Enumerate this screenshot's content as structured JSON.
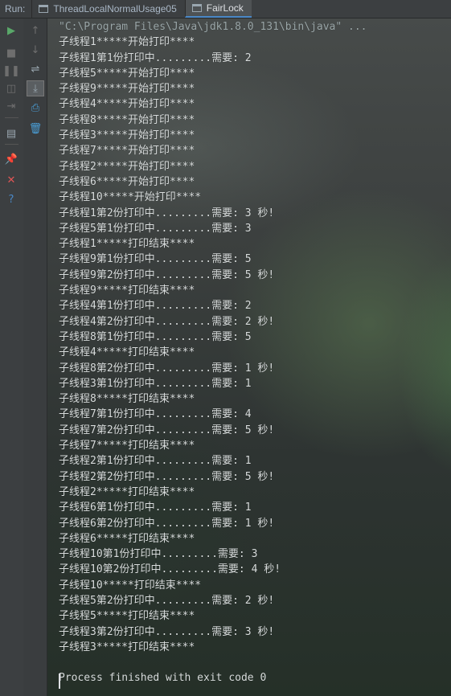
{
  "window": {
    "run_label": "Run:",
    "tabs": [
      {
        "label": "ThreadLocalNormalUsage05",
        "active": false
      },
      {
        "label": "FairLock",
        "active": true
      }
    ]
  },
  "colors": {
    "background": "#2b2d2e",
    "toolbar": "#3c3f41",
    "run_green": "#59a869",
    "close_red": "#e05555",
    "help_blue": "#4a88c7",
    "text": "#d8dcdc"
  },
  "toolbar_left": [
    {
      "name": "rerun-icon",
      "glyph": "▶",
      "color": "#59a869"
    },
    {
      "name": "stop-icon",
      "glyph": "■",
      "color": "#6e6e6e"
    },
    {
      "name": "pause-icon",
      "glyph": "❚❚",
      "color": "#6e6e6e"
    },
    {
      "name": "camera-icon",
      "glyph": "◫",
      "color": "#6e6e6e"
    },
    {
      "name": "exit-icon",
      "glyph": "⇥",
      "color": "#6e6e6e"
    },
    {
      "name": "dump-threads-icon",
      "glyph": "▤",
      "color": "#9aa7b0"
    },
    {
      "name": "pin-tab-icon",
      "glyph": "📌",
      "color": "#c75450"
    },
    {
      "name": "close-icon",
      "glyph": "✕",
      "color": "#e05555"
    },
    {
      "name": "help-icon",
      "glyph": "?",
      "color": "#4a88c7"
    }
  ],
  "toolbar_right": [
    {
      "name": "up-icon",
      "glyph": "↑",
      "color": "#6e6e6e"
    },
    {
      "name": "down-icon",
      "glyph": "↓",
      "color": "#6e6e6e"
    },
    {
      "name": "soft-wrap-icon",
      "glyph": "⇌",
      "color": "#9aa7b0"
    },
    {
      "name": "scroll-to-end-icon",
      "glyph": "⤓",
      "color": "#9aa7b0"
    },
    {
      "name": "print-icon",
      "glyph": "⎙",
      "color": "#4a9fd8"
    },
    {
      "name": "clear-all-icon",
      "glyph": "🗑",
      "color": "#4a9fd8"
    }
  ],
  "console": {
    "lines": [
      "\"C:\\Program Files\\Java\\jdk1.8.0_131\\bin\\java\" ...",
      "子线程1*****开始打印****",
      "子线程1第1份打印中.........需要: 2",
      "子线程5*****开始打印****",
      "子线程9*****开始打印****",
      "子线程4*****开始打印****",
      "子线程8*****开始打印****",
      "子线程3*****开始打印****",
      "子线程7*****开始打印****",
      "子线程2*****开始打印****",
      "子线程6*****开始打印****",
      "子线程10*****开始打印****",
      "子线程1第2份打印中.........需要: 3 秒!",
      "子线程5第1份打印中.........需要: 3",
      "子线程1*****打印结束****",
      "子线程9第1份打印中.........需要: 5",
      "子线程9第2份打印中.........需要: 5 秒!",
      "子线程9*****打印结束****",
      "子线程4第1份打印中.........需要: 2",
      "子线程4第2份打印中.........需要: 2 秒!",
      "子线程8第1份打印中.........需要: 5",
      "子线程4*****打印结束****",
      "子线程8第2份打印中.........需要: 1 秒!",
      "子线程3第1份打印中.........需要: 1",
      "子线程8*****打印结束****",
      "子线程7第1份打印中.........需要: 4",
      "子线程7第2份打印中.........需要: 5 秒!",
      "子线程7*****打印结束****",
      "子线程2第1份打印中.........需要: 1",
      "子线程2第2份打印中.........需要: 5 秒!",
      "子线程2*****打印结束****",
      "子线程6第1份打印中.........需要: 1",
      "子线程6第2份打印中.........需要: 1 秒!",
      "子线程6*****打印结束****",
      "子线程10第1份打印中.........需要: 3",
      "子线程10第2份打印中.........需要: 4 秒!",
      "子线程10*****打印结束****",
      "子线程5第2份打印中.........需要: 2 秒!",
      "子线程5*****打印结束****",
      "子线程3第2份打印中.........需要: 3 秒!",
      "子线程3*****打印结束****",
      "",
      "Process finished with exit code 0"
    ]
  }
}
